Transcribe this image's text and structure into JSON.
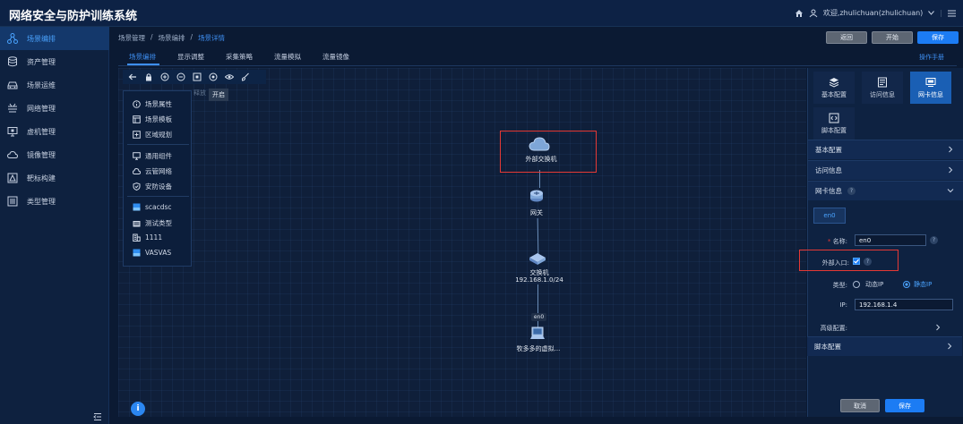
{
  "app": {
    "title": "网络安全与防护训练系统"
  },
  "user": {
    "welcome": "欢迎,zhulichuan(zhulichuan)"
  },
  "sidebar": {
    "items": [
      {
        "label": "场景编排",
        "icon": "topology-icon",
        "active": true
      },
      {
        "label": "资产管理",
        "icon": "database-icon"
      },
      {
        "label": "场景运维",
        "icon": "car-icon"
      },
      {
        "label": "网络管理",
        "icon": "network-icon"
      },
      {
        "label": "虚机管理",
        "icon": "monitor-icon"
      },
      {
        "label": "镜像管理",
        "icon": "cloud-icon"
      },
      {
        "label": "靶标构建",
        "icon": "target-icon"
      },
      {
        "label": "类型管理",
        "icon": "list-icon"
      }
    ]
  },
  "breadcrumb": [
    "场景管理",
    "场景编排",
    "场景详情"
  ],
  "header_buttons": {
    "back": "返回",
    "start": "开始",
    "save": "保存"
  },
  "tabs": [
    "场景编排",
    "显示调整",
    "采集策略",
    "流量模拟",
    "流量镜像"
  ],
  "manual": "操作手册",
  "toolbar": {
    "tooltip": "开启",
    "tooltip_behind": "释放"
  },
  "palette": {
    "group1": [
      "场景属性",
      "场景模板",
      "区域规划"
    ],
    "group2": [
      "通用组件",
      "云管网络",
      "安防设备"
    ],
    "group3": [
      "scacdsc",
      "测试类型",
      "1111",
      "VASVAS"
    ]
  },
  "topology": {
    "nodes": [
      {
        "label": "外部交换机",
        "icon": "cloud-icon"
      },
      {
        "label": "网关",
        "icon": "router-icon"
      },
      {
        "label": "交换机",
        "sublabel": "192.168.1.0/24",
        "icon": "switch-icon"
      },
      {
        "label": "牧多多的虚拟...",
        "icon": "computer-icon"
      }
    ],
    "interface_tag": "en0"
  },
  "panel": {
    "tabs": [
      {
        "label": "基本配置",
        "icon": "layers-icon"
      },
      {
        "label": "访问信息",
        "icon": "document-icon"
      },
      {
        "label": "网卡信息",
        "icon": "nic-icon",
        "active": true
      },
      {
        "label": "脚本配置",
        "icon": "code-icon"
      }
    ],
    "sections": {
      "basic": "基本配置",
      "access": "访问信息",
      "nic": "网卡信息",
      "script": "脚本配置"
    },
    "nic_tab": "en0",
    "form": {
      "name_label": "名称:",
      "name_value": "en0",
      "external_label": "外部入口:",
      "external_checked": true,
      "type_label": "类型:",
      "type_options": [
        "动态IP",
        "静态IP"
      ],
      "type_selected": "静态IP",
      "ip_label": "IP:",
      "ip_value": "192.168.1.4",
      "advanced_label": "高级配置:"
    },
    "buttons": {
      "cancel": "取消",
      "save": "保存"
    }
  }
}
